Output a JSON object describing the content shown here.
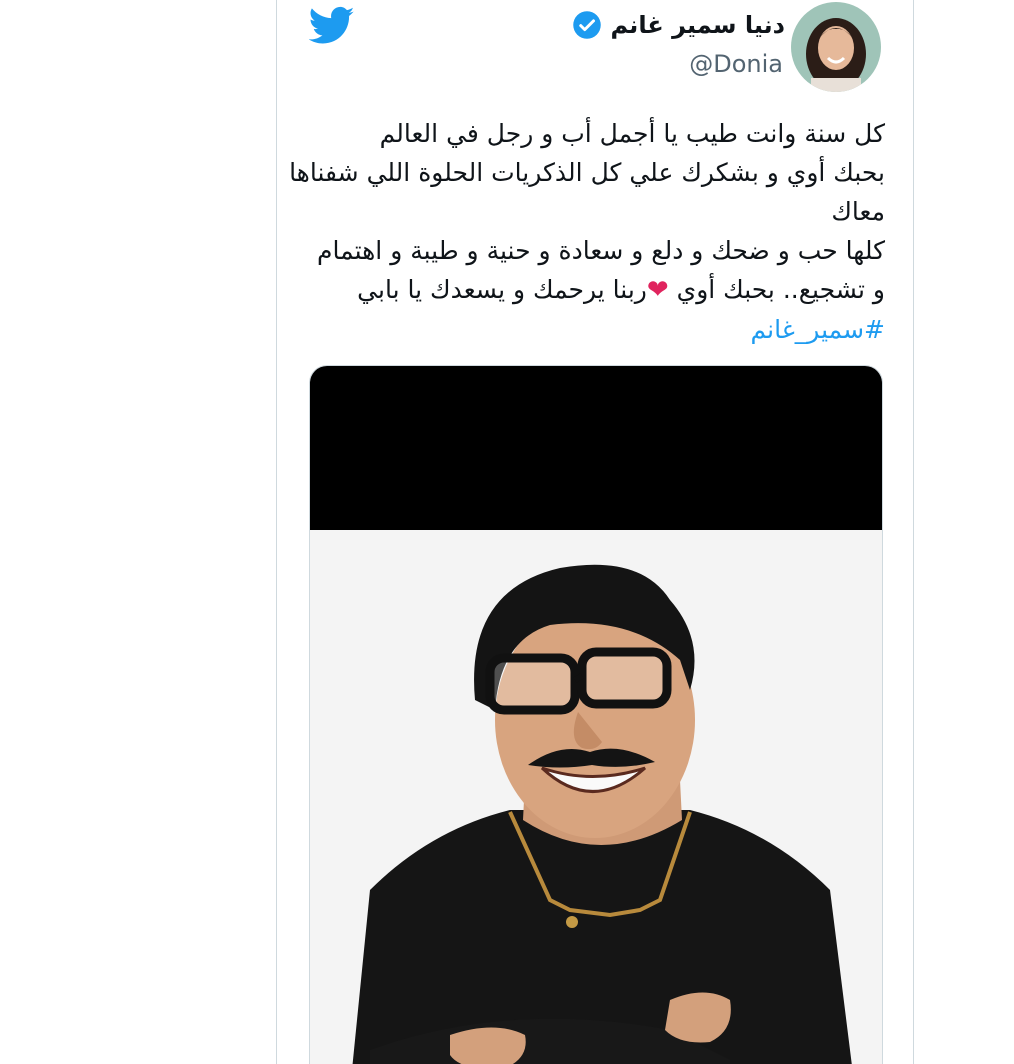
{
  "tweet": {
    "display_name": "دنيا سمير غانم",
    "handle": "@Donia",
    "lines": [
      "كل سنة وانت طيب يا أجمل أب و رجل في العالم",
      "بحبك أوي و بشكرك علي كل الذكريات الحلوة اللي شفناها",
      "معاك",
      "كلها حب و ضحك و دلع و سعادة و حنية و طيبة و اهتمام",
      "و تشجيع.. بحبك أوي",
      "ربنا يرحمك و يسعدك يا بابي"
    ],
    "hashtag": "#سمير_غانم",
    "emoji": "❤"
  },
  "icons": {
    "logo": "twitter-bird-icon",
    "verified": "verified-badge-icon"
  },
  "colors": {
    "brand": "#1d9bf0",
    "heart": "#e0245e",
    "text": "#0f1419",
    "muted": "#536471"
  }
}
